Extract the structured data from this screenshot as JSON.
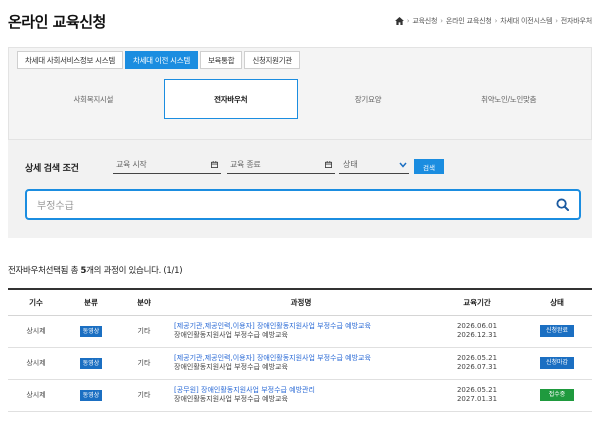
{
  "header": {
    "title": "온라인 교육신청",
    "breadcrumb": [
      "교육신청",
      "온라인 교육신청",
      "차세대 이전시스템",
      "전자바우처"
    ]
  },
  "system_tabs": [
    "차세대 사회서비스정보 시스템",
    "차세대 이전 시스템",
    "보육통합",
    "신청지원기관"
  ],
  "sub_tabs": [
    "사회복지시설",
    "전자바우처",
    "장기요양",
    "취약노인/노인맞춤"
  ],
  "search": {
    "label": "상세 검색 조건",
    "start_placeholder": "교육 시작",
    "end_placeholder": "교육 종료",
    "status_placeholder": "상태",
    "button": "검색",
    "keyword": "부정수급"
  },
  "result": {
    "prefix": "전자바우처선택됨 총 ",
    "count": "5",
    "suffix": "개의 과정이 있습니다. (1/1)"
  },
  "table": {
    "headers": [
      "기수",
      "분류",
      "분야",
      "과정명",
      "교육기간",
      "상태"
    ],
    "rows": [
      {
        "term": "상시제",
        "category": "동영상",
        "field": "기타",
        "title": "[제공기관,제공인력,이용자] 장애인활동지원사업 부정수급 예방교육",
        "subtitle": "장애인활동지원사업 부정수급 예방교육",
        "start": "2026.06.01",
        "end": "2026.12.31",
        "status": "신청완료",
        "status_color": "#1b6fc2"
      },
      {
        "term": "상시제",
        "category": "동영상",
        "field": "기타",
        "title": "[제공기관,제공인력,이용자] 장애인활동지원사업 부정수급 예방교육",
        "subtitle": "장애인활동지원사업 부정수급 예방교육",
        "start": "2026.05.21",
        "end": "2026.07.31",
        "status": "신청마감",
        "status_color": "#1b6fc2"
      },
      {
        "term": "상시제",
        "category": "동영상",
        "field": "기타",
        "title": "[공무원] 장애인활동지원사업 부정수급 예방관리",
        "subtitle": "장애인활동지원사업 부정수급 예방교육",
        "start": "2026.05.21",
        "end": "2027.01.31",
        "status": "접수중",
        "status_color": "#1f9a3e"
      }
    ]
  },
  "colors": {
    "accent": "#1b8de0",
    "badge_blue": "#1b6fc2",
    "badge_green": "#1f9a3e"
  }
}
